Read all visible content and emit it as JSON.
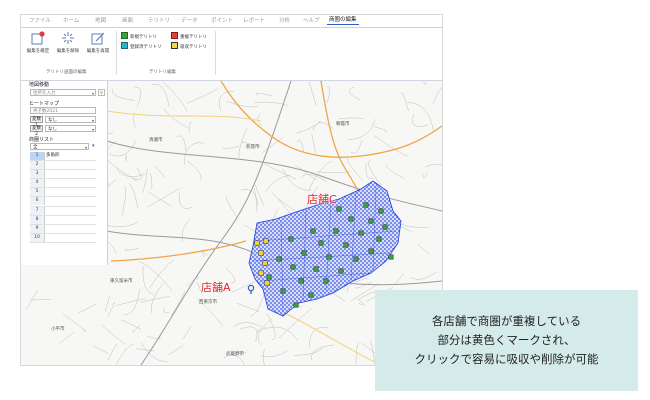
{
  "menu": {
    "tabs": [
      "ファイル",
      "ホーム",
      "地図",
      "画面",
      "テリトリ",
      "データ",
      "ポイント",
      "レポート",
      "分析",
      "ヘルプ",
      "商圏の編集"
    ],
    "active_tab": "商圏の編集"
  },
  "ribbon": {
    "buttons": [
      {
        "label": "編集を確定",
        "icon": "confirm-edit-icon"
      },
      {
        "label": "編集を解除",
        "icon": "cancel-edit-icon"
      },
      {
        "label": "編集を再開",
        "icon": "resume-edit-icon"
      }
    ],
    "group1_label": "テリトリ画面の編集",
    "group2_label": "テリトリ編集",
    "legend": [
      {
        "label": "新規テリトリ",
        "color": "#3aa23a"
      },
      {
        "label": "重複テリトリ",
        "color": "#e23c3c"
      },
      {
        "label": "登録済テリトリ",
        "color": "#2fb6c6"
      },
      {
        "label": "吸収テリトリ",
        "color": "#f2d83b"
      }
    ]
  },
  "panel": {
    "map_move_title": "地図移動",
    "address_placeholder": "住所を入力",
    "heatmap_title": "ヒートマップ",
    "heatmap_value": "男子数2021",
    "var1_label": "変数1",
    "var1_value": "なし",
    "var2_label": "変数2",
    "var2_value": "なし",
    "list_title": "商圏リスト",
    "list_filter": "全",
    "rows": [
      {
        "num": "1",
        "value": "多角形"
      },
      {
        "num": "2",
        "value": ""
      },
      {
        "num": "3",
        "value": ""
      },
      {
        "num": "4",
        "value": ""
      },
      {
        "num": "5",
        "value": ""
      },
      {
        "num": "6",
        "value": ""
      },
      {
        "num": "7",
        "value": ""
      },
      {
        "num": "8",
        "value": ""
      },
      {
        "num": "9",
        "value": ""
      },
      {
        "num": "10",
        "value": ""
      }
    ]
  },
  "map": {
    "store_a": "店舗A",
    "store_c": "店舗C",
    "place_labels": [
      "清瀬市",
      "東久留米市",
      "西東京市",
      "小平市",
      "武蔵野市",
      "新座市",
      "朝霞市"
    ],
    "area_color": "#1f3fe0",
    "marker_new_color": "#3aa23a",
    "marker_absorb_color": "#f2d83b"
  },
  "callout": {
    "lines": [
      "各店舗で商圏が重複している",
      "部分は黄色くマークされ、",
      "クリックで容易に吸収や削除が可能"
    ],
    "background": "#d4ebe9"
  }
}
